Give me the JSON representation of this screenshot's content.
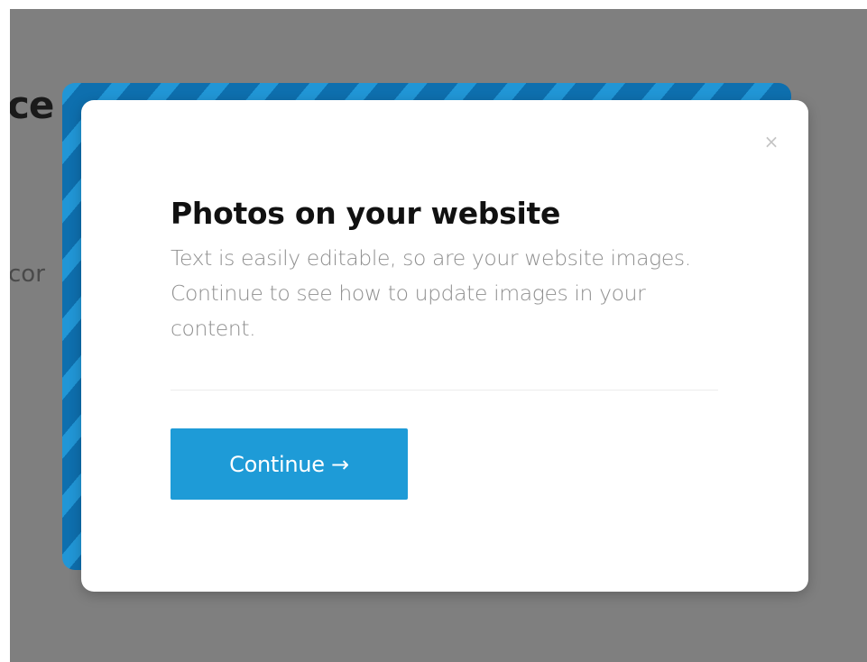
{
  "background": {
    "heading_fragment": "ce",
    "text_fragment": "cor"
  },
  "modal": {
    "close_label": "×",
    "title": "Photos on your website",
    "body": "Text is easily editable, so are your website images. Continue to see how to update images in your content.",
    "continue_label": "Continue →"
  },
  "colors": {
    "accent": "#1e9bd7",
    "stripe_dark": "#0e6fae",
    "stripe_light": "#2196d6",
    "overlay": "#7f7f7f"
  }
}
